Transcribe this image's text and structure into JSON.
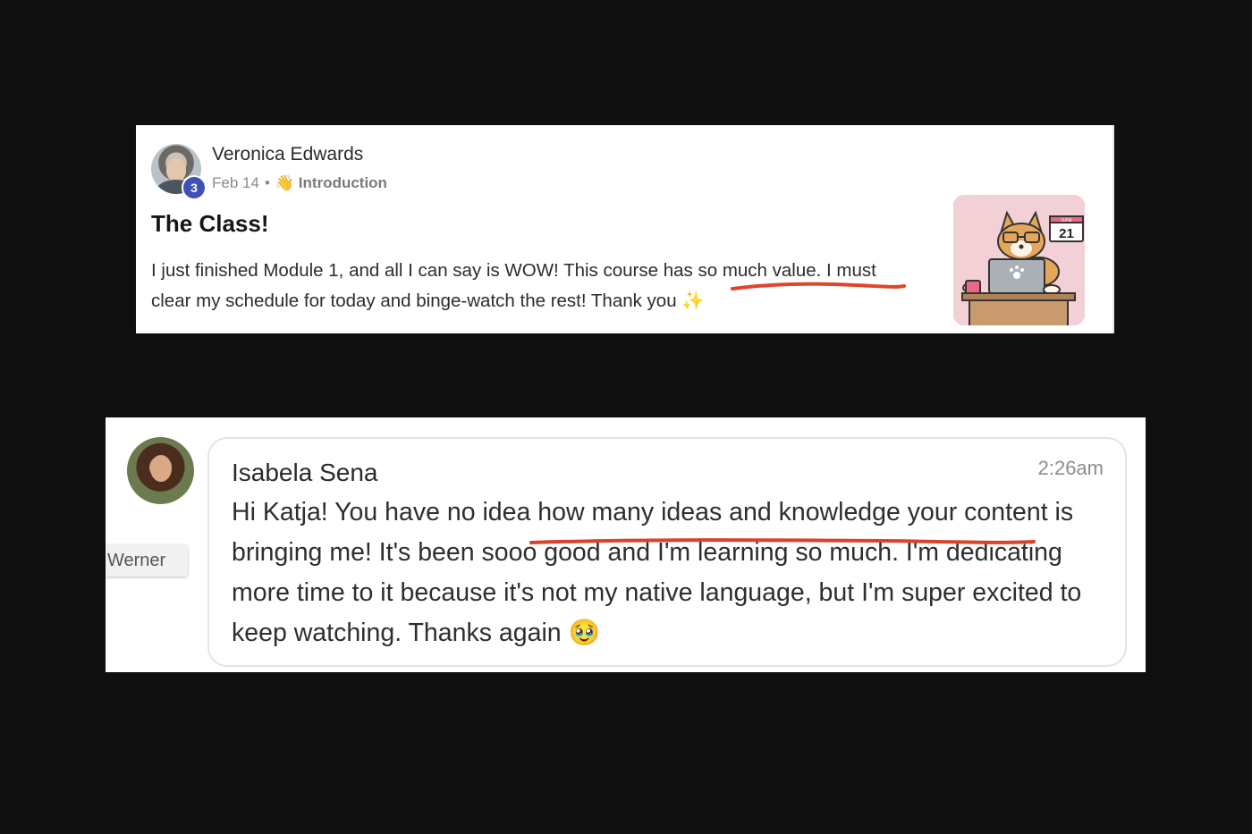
{
  "post": {
    "author": "Veronica Edwards",
    "level": "3",
    "date": "Feb 14",
    "separator": "•",
    "category_icon": "👋",
    "category": "Introduction",
    "title": "The Class!",
    "body": "I just finished Module 1, and all I can say is WOW! This course has so much value. I must clear my schedule for today and binge-watch the rest! Thank you ✨",
    "thumbnail": {
      "icon": "corgi-at-laptop-illustration",
      "calendar_month": "JUNE",
      "calendar_day": "21"
    },
    "highlight_color": "#e0442a"
  },
  "comment": {
    "author": "Isabela Sena",
    "time": "2:26am",
    "mention_chip": "Werner",
    "body": "Hi Katja! You have no idea how many ideas and knowledge your content is bringing me! It's been sooo good and I'm learning so much. I'm dedicating more time to it because it's not my native language, but I'm super excited to keep watching. Thanks again 🥹",
    "highlight_color": "#d8432b"
  },
  "colors": {
    "background": "#0f0f10",
    "card": "#ffffff",
    "badge": "#3f51b5"
  }
}
